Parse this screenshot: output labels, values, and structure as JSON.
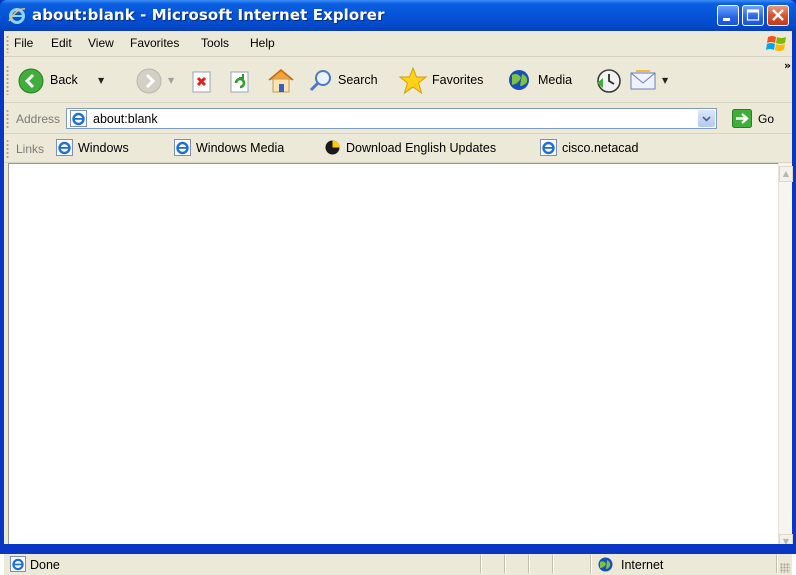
{
  "window": {
    "title": "about:blank - Microsoft Internet Explorer",
    "icon": "ie-icon",
    "controls": [
      "minimize",
      "maximize",
      "close"
    ]
  },
  "menubar": {
    "items": [
      {
        "label": "File"
      },
      {
        "label": "Edit"
      },
      {
        "label": "View"
      },
      {
        "label": "Favorites"
      },
      {
        "label": "Tools"
      },
      {
        "label": "Help"
      }
    ]
  },
  "toolbar": {
    "back_label": "Back",
    "search_label": "Search",
    "favorites_label": "Favorites",
    "media_label": "Media",
    "overflow": "»"
  },
  "addressbar": {
    "label": "Address",
    "value": "about:blank",
    "go_label": "Go"
  },
  "linksbar": {
    "label": "Links",
    "links": [
      {
        "label": "Windows",
        "icon": "ie-icon"
      },
      {
        "label": "Windows Media",
        "icon": "ie-icon"
      },
      {
        "label": "Download English Updates",
        "icon": "update-icon"
      },
      {
        "label": "cisco.netacad",
        "icon": "ie-icon"
      }
    ]
  },
  "statusbar": {
    "text": "Done",
    "zone": "Internet"
  },
  "colors": {
    "titlebar": "#0553d8",
    "chrome": "#ece9d8",
    "back_green": "#3fae3a"
  }
}
